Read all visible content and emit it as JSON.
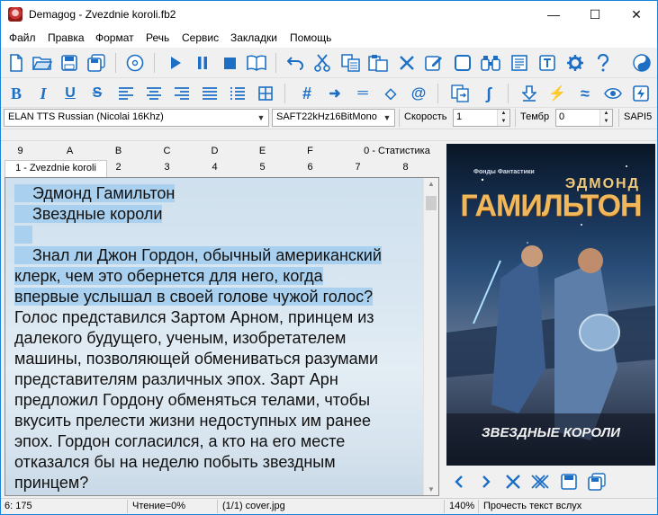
{
  "window": {
    "title": "Demagog - Zvezdnie koroli.fb2",
    "minimize": "—",
    "maximize": "☐",
    "close": "✕"
  },
  "menu": [
    "Файл",
    "Правка",
    "Формат",
    "Речь",
    "Сервис",
    "Закладки",
    "Помощь"
  ],
  "toolbar1": [
    "new-file-icon",
    "open-folder-icon",
    "save-icon",
    "save-all-icon",
    "cd-icon",
    "play-icon",
    "pause-icon",
    "stop-icon",
    "book-icon",
    "undo-icon",
    "cut-icon",
    "copy-icon",
    "paste-icon",
    "delete-icon",
    "edit-icon",
    "frame-icon",
    "binoculars-icon",
    "text-box-icon",
    "text-t-icon",
    "settings-gear-icon",
    "help-icon",
    "yin-yang-icon"
  ],
  "toolbar2": [
    "bold-icon",
    "italic-icon",
    "underline-icon",
    "strikethrough-icon",
    "align-left-icon",
    "align-center-icon",
    "align-right-icon",
    "justify-icon",
    "list-icon",
    "table-icon",
    "hash-icon",
    "arrow-right-icon",
    "equals-icon",
    "diamond-icon",
    "at-icon",
    "convert-icon",
    "integral-icon",
    "download-icon",
    "lightning-icon",
    "approx-icon",
    "eye-icon",
    "lightning-box-icon"
  ],
  "toolbar2_glyphs": {
    "bold": "B",
    "italic": "I",
    "underline": "U",
    "strikethrough": "S",
    "hash": "#",
    "arrow": "➜",
    "equals": "═",
    "diamond": "◇",
    "at": "@",
    "integral": "∫",
    "lightning": "⚡",
    "approx": "≈",
    "eye": "👁"
  },
  "voice": {
    "voice_value": "ELAN TTS Russian (Nicolai 16Khz)",
    "format_value": "SAFT22kHz16BitMono",
    "speed_label": "Скорость",
    "speed_value": "1",
    "timbre_label": "Тембр",
    "timbre_value": "0",
    "engine": "SAPI5"
  },
  "tabs_row1": [
    "9",
    "A",
    "B",
    "C",
    "D",
    "E",
    "F",
    "0 - Статистика"
  ],
  "tabs_row2": [
    "1 - Zvezdnie koroli",
    "2",
    "3",
    "4",
    "5",
    "6",
    "7",
    "8"
  ],
  "text": {
    "lines": [
      {
        "t": "    Эдмонд Гамильтон",
        "hl": true
      },
      {
        "t": "    Звездные короли",
        "hl": true
      },
      {
        "t": "    ",
        "hl": true
      },
      {
        "t": "    Знал ли Джон Гордон, обычный американский",
        "hl": true
      },
      {
        "t": "клерк, чем это обернется для него, когда",
        "hl": true
      },
      {
        "t": "впервые услышал в своей голове чужой голос?",
        "hl": true
      },
      {
        "t": "Голос представился Зартом Арном, принцем из",
        "hl": false
      },
      {
        "t": "далекого будущего, ученым, изобретателем",
        "hl": false
      },
      {
        "t": "машины, позволяющей обмениваться разумами",
        "hl": false
      },
      {
        "t": "представителям различных эпох. Зарт Арн",
        "hl": false
      },
      {
        "t": "предложил Гордону обменяться телами, чтобы",
        "hl": false
      },
      {
        "t": "вкусить прелести жизни недоступных им ранее",
        "hl": false
      },
      {
        "t": "эпох. Гордон согласился, а кто на его месте",
        "hl": false
      },
      {
        "t": "отказался бы на неделю побыть звездным",
        "hl": false
      },
      {
        "t": "принцем?",
        "hl": false
      }
    ]
  },
  "cover": {
    "series": "Фонды Фантастики",
    "author": "ЭДМОНД",
    "author2": "ГАМИЛЬТОН",
    "book_title": "ЗВЕЗДНЫЕ КОРОЛИ"
  },
  "image_nav": [
    "prev-icon",
    "next-icon",
    "close-x-icon",
    "close-all-icon",
    "save-image-icon",
    "save-all-images-icon"
  ],
  "status": {
    "position": "6: 175",
    "reading": "Чтение=0%",
    "image": "(1/1) cover.jpg",
    "zoom": "140%",
    "action": "Прочесть текст вслух"
  }
}
